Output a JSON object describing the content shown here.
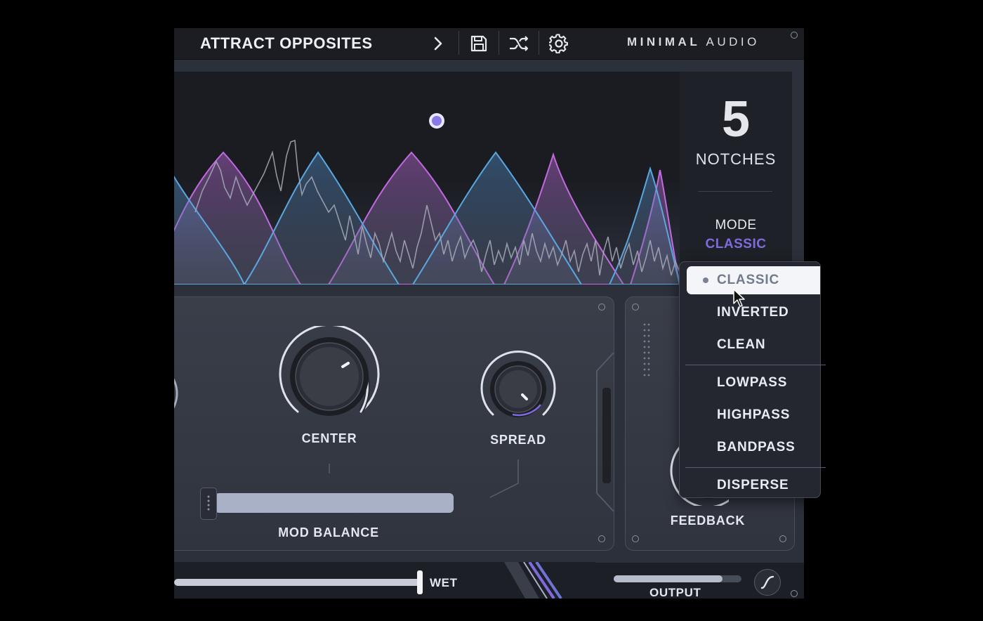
{
  "header": {
    "preset_name": "ATTRACT OPPOSITES",
    "next_icon": "chevron-right-icon",
    "save_icon": "save-icon",
    "random_icon": "shuffle-icon",
    "settings_icon": "gear-icon",
    "brand_bold": "MINIMAL",
    "brand_light": "AUDIO"
  },
  "notch_panel": {
    "count": "5",
    "count_label": "NOTCHES",
    "mode_label": "MODE",
    "mode_value": "CLASSIC"
  },
  "controls": {
    "center_label": "CENTER",
    "spread_label": "SPREAD",
    "mod_balance_label": "MOD BALANCE",
    "feedback_label": "FEEDBACK"
  },
  "footer": {
    "wet_label": "WET",
    "wet_level": 1.0,
    "output_label": "OUTPUT",
    "output_level": 0.85
  },
  "mode_menu": {
    "selected": "CLASSIC",
    "groups": [
      [
        "CLASSIC",
        "INVERTED",
        "CLEAN"
      ],
      [
        "LOWPASS",
        "HIGHPASS",
        "BANDPASS"
      ],
      [
        "DISPERSE"
      ]
    ]
  },
  "colors": {
    "accent_purple": "#7f6ae0",
    "notch_pink": "#c26be0",
    "notch_blue": "#5aa7e0",
    "background": "#2c303a"
  }
}
